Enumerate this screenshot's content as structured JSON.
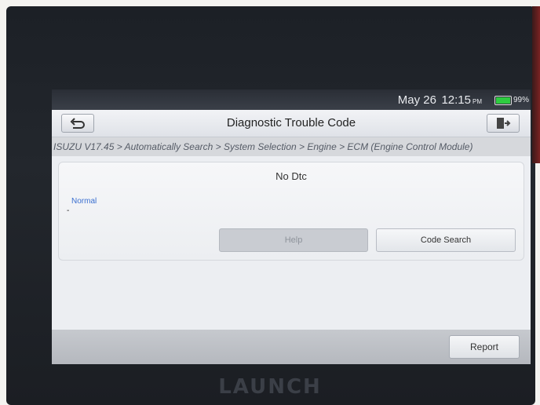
{
  "statusbar": {
    "date": "May 26",
    "time": "12:15",
    "ampm": "PM",
    "battery_percent": 99,
    "battery_label": "99%",
    "battery_color": "#2ecc40"
  },
  "titlebar": {
    "title": "Diagnostic Trouble Code",
    "back_icon": "back-arrow-icon",
    "exit_icon": "exit-door-icon"
  },
  "breadcrumb": {
    "path": "ISUZU V17.45 > Automatically Search > System Selection > Engine > ECM (Engine Control Module)"
  },
  "panel": {
    "dtc_status": "No Dtc",
    "normal_label": "Normal",
    "normal_value": "-",
    "help_label": "Help",
    "code_search_label": "Code Search"
  },
  "footer": {
    "report_label": "Report"
  },
  "device": {
    "brand": "LAUNCH"
  }
}
